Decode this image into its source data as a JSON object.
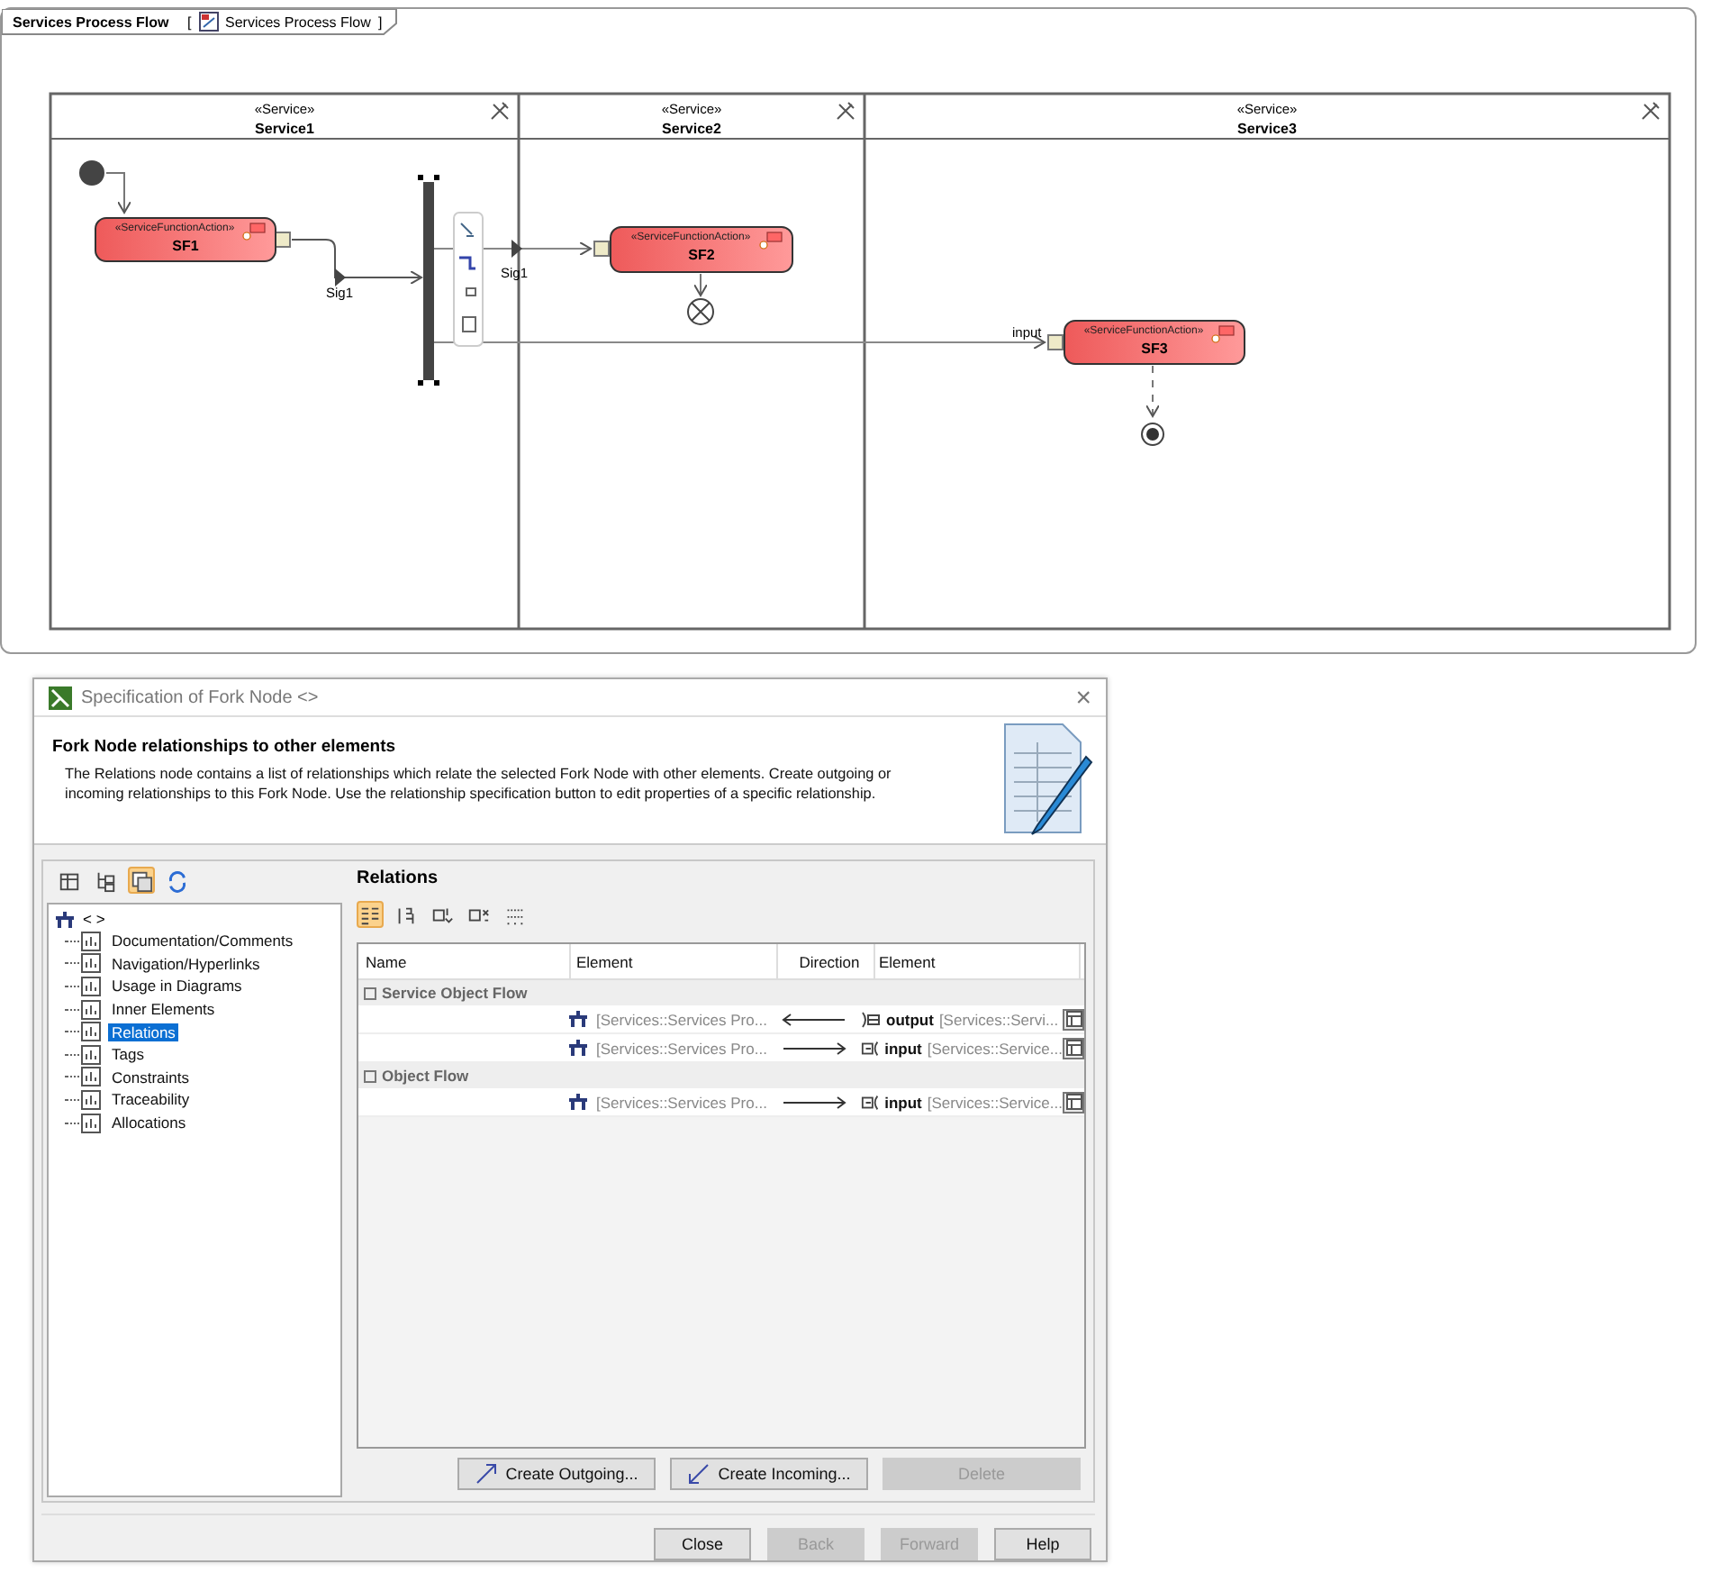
{
  "diagram": {
    "title": "Services Process Flow",
    "bracket_open": "[",
    "reference": "Services Process Flow",
    "bracket_close": "]",
    "lanes": [
      {
        "stereotype": "«Service»",
        "name": "Service1"
      },
      {
        "stereotype": "«Service»",
        "name": "Service2"
      },
      {
        "stereotype": "«Service»",
        "name": "Service3"
      }
    ],
    "actions": [
      {
        "stereotype": "«ServiceFunctionAction»",
        "name": "SF1"
      },
      {
        "stereotype": "«ServiceFunctionAction»",
        "name": "SF2"
      },
      {
        "stereotype": "«ServiceFunctionAction»",
        "name": "SF3"
      }
    ],
    "edge_labels": [
      "Sig1",
      "Sig1",
      "input"
    ]
  },
  "dialog": {
    "title": "Specification of Fork Node <>",
    "close": "×",
    "header": {
      "title": "Fork Node relationships to other elements",
      "description": "The Relations node contains a list of relationships which relate the selected Fork Node with other elements. Create outgoing or incoming relationships to this Fork Node. Use the relationship specification button to edit properties of a specific relationship."
    },
    "tree_toolbar": [
      {
        "selected": false
      },
      {
        "selected": false
      },
      {
        "selected": true
      },
      {
        "selected": false
      }
    ],
    "tree": {
      "label": "< >",
      "children": [
        {
          "label": "Documentation/Comments",
          "selected": false
        },
        {
          "label": "Navigation/Hyperlinks",
          "selected": false
        },
        {
          "label": "Usage in Diagrams",
          "selected": false
        },
        {
          "label": "Inner Elements",
          "selected": false
        },
        {
          "label": "Relations",
          "selected": true
        },
        {
          "label": "Tags",
          "selected": false
        },
        {
          "label": "Constraints",
          "selected": false
        },
        {
          "label": "Traceability",
          "selected": false
        },
        {
          "label": "Allocations",
          "selected": false
        }
      ]
    },
    "section_title": "Relations",
    "table_toolbar": [
      {
        "selected": true
      },
      {
        "selected": false
      },
      {
        "selected": false
      },
      {
        "selected": false
      },
      {
        "selected": false
      }
    ],
    "columns": [
      "Name",
      "Element",
      "Direction",
      "Element"
    ],
    "groups": [
      {
        "name": "Service Object Flow",
        "expanded": true,
        "rows": [
          {
            "kind": "incoming",
            "element": "[Services::Services Pro...",
            "target_name": "output",
            "target_path": "[Services::Servi..."
          },
          {
            "kind": "outgoing",
            "element": "[Services::Services Pro...",
            "target_name": "input",
            "target_path": "[Services::Service..."
          }
        ]
      },
      {
        "name": "Object Flow",
        "expanded": true,
        "rows": [
          {
            "kind": "outgoing",
            "element": "[Services::Services Pro...",
            "target_name": "input",
            "target_path": "[Services::Service..."
          }
        ]
      }
    ],
    "actions": [
      {
        "label": "Create Outgoing...",
        "kind": "outgoing",
        "disabled": false
      },
      {
        "label": "Create Incoming...",
        "kind": "incoming",
        "disabled": false
      },
      {
        "label": "Delete",
        "kind": "plain",
        "disabled": true
      }
    ],
    "buttons": [
      {
        "label": "Close",
        "disabled": false
      },
      {
        "label": "Back",
        "disabled": true
      },
      {
        "label": "Forward",
        "disabled": true
      },
      {
        "label": "Help",
        "disabled": false
      }
    ]
  }
}
